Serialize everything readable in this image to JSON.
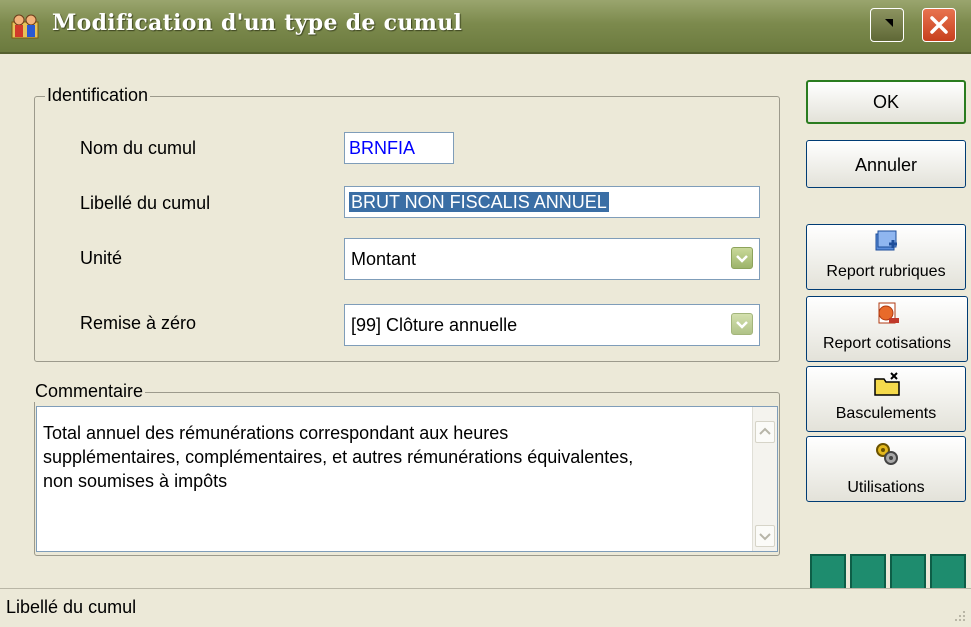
{
  "window": {
    "title": "Modification d'un type de cumul",
    "minimize_label": "",
    "close_label": ""
  },
  "identification": {
    "group_title": "Identification",
    "nom_label": "Nom du cumul",
    "nom_value": "BRNFIA",
    "libelle_label": "Libellé du cumul",
    "libelle_value": "BRUT NON FISCALIS ANNUEL",
    "unite_label": "Unité",
    "unite_value": "Montant",
    "remise_label": "Remise à zéro",
    "remise_value": "[99] Clôture annuelle"
  },
  "commentaire": {
    "group_title": "Commentaire",
    "text_line1": "Total annuel des rémunérations correspondant aux heures",
    "text_line2": "supplémentaires, complémentaires, et autres rémunérations équivalentes,",
    "text_line3": "non soumises à impôts"
  },
  "buttons": {
    "ok": "OK",
    "annuler": "Annuler",
    "report_rubriques": "Report rubriques",
    "report_cotisations": "Report cotisations",
    "basculements": "Basculements",
    "utilisations": "Utilisations"
  },
  "statusbar": {
    "text": "Libellé du cumul"
  },
  "colors": {
    "titlebar": "#7C8A4D",
    "nav_accent": "#1E8C6E",
    "value_blue": "#0000FF"
  }
}
